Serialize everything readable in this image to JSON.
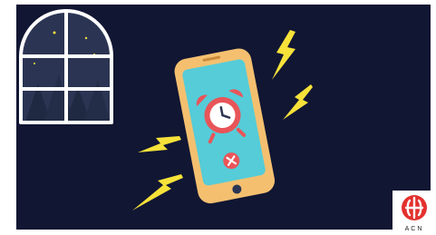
{
  "scene": {
    "background": "#111633",
    "elements": [
      "night-window",
      "ringing-phone",
      "alarm-clock-icon",
      "dismiss-button",
      "lightning-bolts"
    ]
  },
  "phone": {
    "body_color": "#f4c070",
    "screen_color": "#55ccd8",
    "clock_color": "#e85558",
    "dismiss_icon": "close-icon"
  },
  "bolt_color": "#f7e23a",
  "logo": {
    "name": "ACN",
    "label": "ACN",
    "color": "#e3312f"
  }
}
